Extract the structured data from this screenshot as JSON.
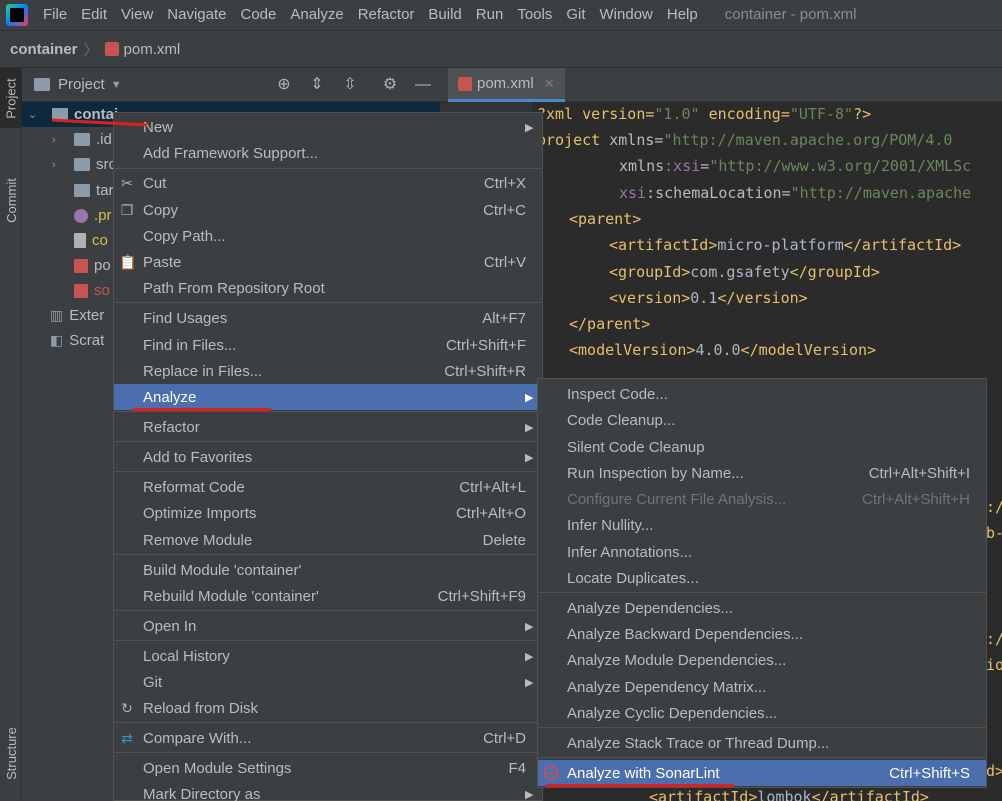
{
  "menubar": {
    "items": [
      "File",
      "Edit",
      "View",
      "Navigate",
      "Code",
      "Analyze",
      "Refactor",
      "Build",
      "Run",
      "Tools",
      "Git",
      "Window",
      "Help"
    ],
    "title": "container - pom.xml"
  },
  "navbar": {
    "project": "container",
    "file": "pom.xml"
  },
  "left_strip": {
    "project_tab": "Project",
    "commit_tab": "Commit",
    "structure_tab": "Structure"
  },
  "project_panel": {
    "title": "Project"
  },
  "tree": {
    "root": "contai",
    "items": [
      ".id",
      "src",
      "tar",
      ".pr",
      "co",
      "po",
      "so",
      "Exter",
      "Scrat"
    ]
  },
  "editor_tab": {
    "label": "pom.xml"
  },
  "code": {
    "l1": {
      "a": "?xml version=",
      "b": "\"1.0\"",
      "c": " encoding=",
      "d": "\"UTF-8\"",
      "e": "?>"
    },
    "l2": {
      "a": "project ",
      "b": "xmlns",
      "c": "=",
      "d": "\"http://maven.apache.org/POM/4.0"
    },
    "l3": {
      "a": "xmlns",
      "b": ":xsi",
      "c": "=",
      "d": "\"http://www.w3.org/2001/XMLSc"
    },
    "l4": {
      "a": "xsi",
      "b": ":schemaLocation",
      "c": "=",
      "d": "\"http://maven.apache"
    },
    "l5": "<parent>",
    "l6": {
      "a": "<artifactId>",
      "b": "micro-platform",
      "c": "</artifactId>"
    },
    "l7": {
      "a": "<groupId>",
      "b": "com.gsafety",
      "c": "</groupId>"
    },
    "l8": {
      "a": "<version>",
      "b": "0.1",
      "c": "</version>"
    },
    "l9": "</parent>",
    "l10": {
      "a": "<modelVersion>",
      "b": "4.0.0",
      "c": "</modelVersion>"
    },
    "r1": "t:/",
    "r2": "eb-",
    "r3": "t:/",
    "r4": "tio",
    "r5": "Id>",
    "l_last": {
      "a": "<artifactId>",
      "b": "lombok",
      "c": "</artifactId>"
    }
  },
  "context_menu": {
    "new": "New",
    "add_framework": "Add Framework Support...",
    "cut": "Cut",
    "cut_sc": "Ctrl+X",
    "copy": "Copy",
    "copy_sc": "Ctrl+C",
    "copy_path": "Copy Path...",
    "paste": "Paste",
    "paste_sc": "Ctrl+V",
    "path_from_root": "Path From Repository Root",
    "find_usages": "Find Usages",
    "find_usages_sc": "Alt+F7",
    "find_in_files": "Find in Files...",
    "find_in_files_sc": "Ctrl+Shift+F",
    "replace_in_files": "Replace in Files...",
    "replace_in_files_sc": "Ctrl+Shift+R",
    "analyze": "Analyze",
    "refactor": "Refactor",
    "add_favorites": "Add to Favorites",
    "reformat": "Reformat Code",
    "reformat_sc": "Ctrl+Alt+L",
    "optimize": "Optimize Imports",
    "optimize_sc": "Ctrl+Alt+O",
    "remove_module": "Remove Module",
    "remove_module_sc": "Delete",
    "build_module": "Build Module 'container'",
    "rebuild_module": "Rebuild Module 'container'",
    "rebuild_module_sc": "Ctrl+Shift+F9",
    "open_in": "Open In",
    "local_history": "Local History",
    "git": "Git",
    "reload": "Reload from Disk",
    "compare": "Compare With...",
    "compare_sc": "Ctrl+D",
    "module_settings": "Open Module Settings",
    "module_settings_sc": "F4",
    "mark_dir": "Mark Directory as"
  },
  "analyze_menu": {
    "inspect": "Inspect Code...",
    "cleanup": "Code Cleanup...",
    "silent_cleanup": "Silent Code Cleanup",
    "run_inspection": "Run Inspection by Name...",
    "run_inspection_sc": "Ctrl+Alt+Shift+I",
    "configure": "Configure Current File Analysis...",
    "configure_sc": "Ctrl+Alt+Shift+H",
    "infer_nullity": "Infer Nullity...",
    "infer_annotations": "Infer Annotations...",
    "locate_duplicates": "Locate Duplicates...",
    "deps": "Analyze Dependencies...",
    "back_deps": "Analyze Backward Dependencies...",
    "module_deps": "Analyze Module Dependencies...",
    "dep_matrix": "Analyze Dependency Matrix...",
    "cyclic_deps": "Analyze Cyclic Dependencies...",
    "stack_trace": "Analyze Stack Trace or Thread Dump...",
    "sonarlint": "Analyze with SonarLint",
    "sonarlint_sc": "Ctrl+Shift+S"
  },
  "colors": {
    "selection": "#4b6eaf",
    "annotation_red": "#e01e1e"
  }
}
